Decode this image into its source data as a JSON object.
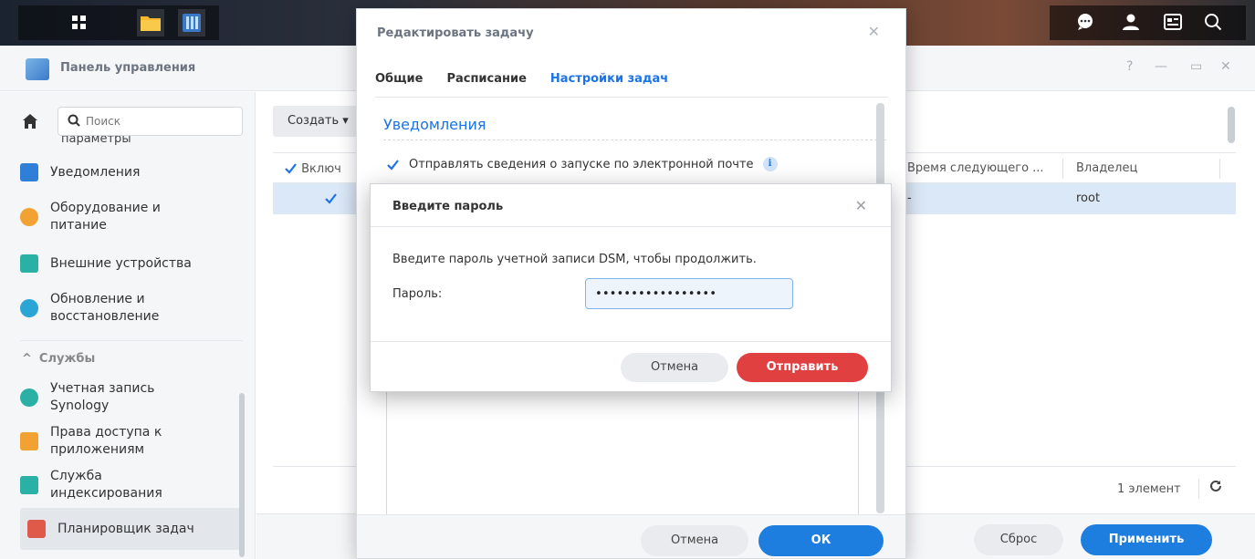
{
  "taskbar": {
    "left_icons": [
      "grid-apps-icon",
      "file-station-icon",
      "control-panel-icon"
    ],
    "right_icons": [
      "chat-icon",
      "user-icon",
      "widgets-icon",
      "search-icon"
    ]
  },
  "window": {
    "title": "Панель управления"
  },
  "sidebar": {
    "search_placeholder": "Поиск",
    "cut_off_label": "параметры",
    "items": [
      {
        "label": "Уведомления",
        "icon": "notifications-icon",
        "color": "#2f7fd8"
      },
      {
        "label": "Оборудование и питание",
        "icon": "bulb-icon",
        "color": "#f2a233"
      },
      {
        "label": "Внешние устройства",
        "icon": "external-device-icon",
        "color": "#2bb0a5"
      },
      {
        "label": "Обновление и восстановление",
        "icon": "update-icon",
        "color": "#2aa5d6"
      },
      {
        "label": "Учетная запись Synology",
        "icon": "synology-account-icon",
        "color": "#2bb0a5"
      },
      {
        "label": "Права доступа к приложениям",
        "icon": "lock-icon",
        "color": "#f2a233"
      },
      {
        "label": "Служба индексирования",
        "icon": "index-service-icon",
        "color": "#2bb0a5"
      },
      {
        "label": "Планировщик задач",
        "icon": "calendar-icon",
        "color": "#e05a4a"
      }
    ],
    "services_label": "Службы"
  },
  "main": {
    "create_label": "Создать ▾",
    "columns": [
      "Включ",
      "Время следующего ...",
      "Владелец"
    ],
    "row": {
      "next_time": "-",
      "owner": "root"
    },
    "count": "1 элемент",
    "reset_label": "Сброс",
    "apply_label": "Применить"
  },
  "edit_dialog": {
    "title": "Редактировать задачу",
    "tabs": [
      "Общие",
      "Расписание",
      "Настройки задач"
    ],
    "active_tab": "Настройки задач",
    "section_title": "Уведомления",
    "email_option": "Отправлять сведения о запуске по электронной почте",
    "info_glyph": "i",
    "cancel_label": "Отмена",
    "ok_label": "ОК"
  },
  "password_dialog": {
    "title": "Введите пароль",
    "message": "Введите пароль учетной записи DSM, чтобы продолжить.",
    "field_label": "Пароль:",
    "field_value": "•••••••••••••••••",
    "cancel_label": "Отмена",
    "submit_label": "Отправить",
    "submit_color": "#e04040"
  }
}
